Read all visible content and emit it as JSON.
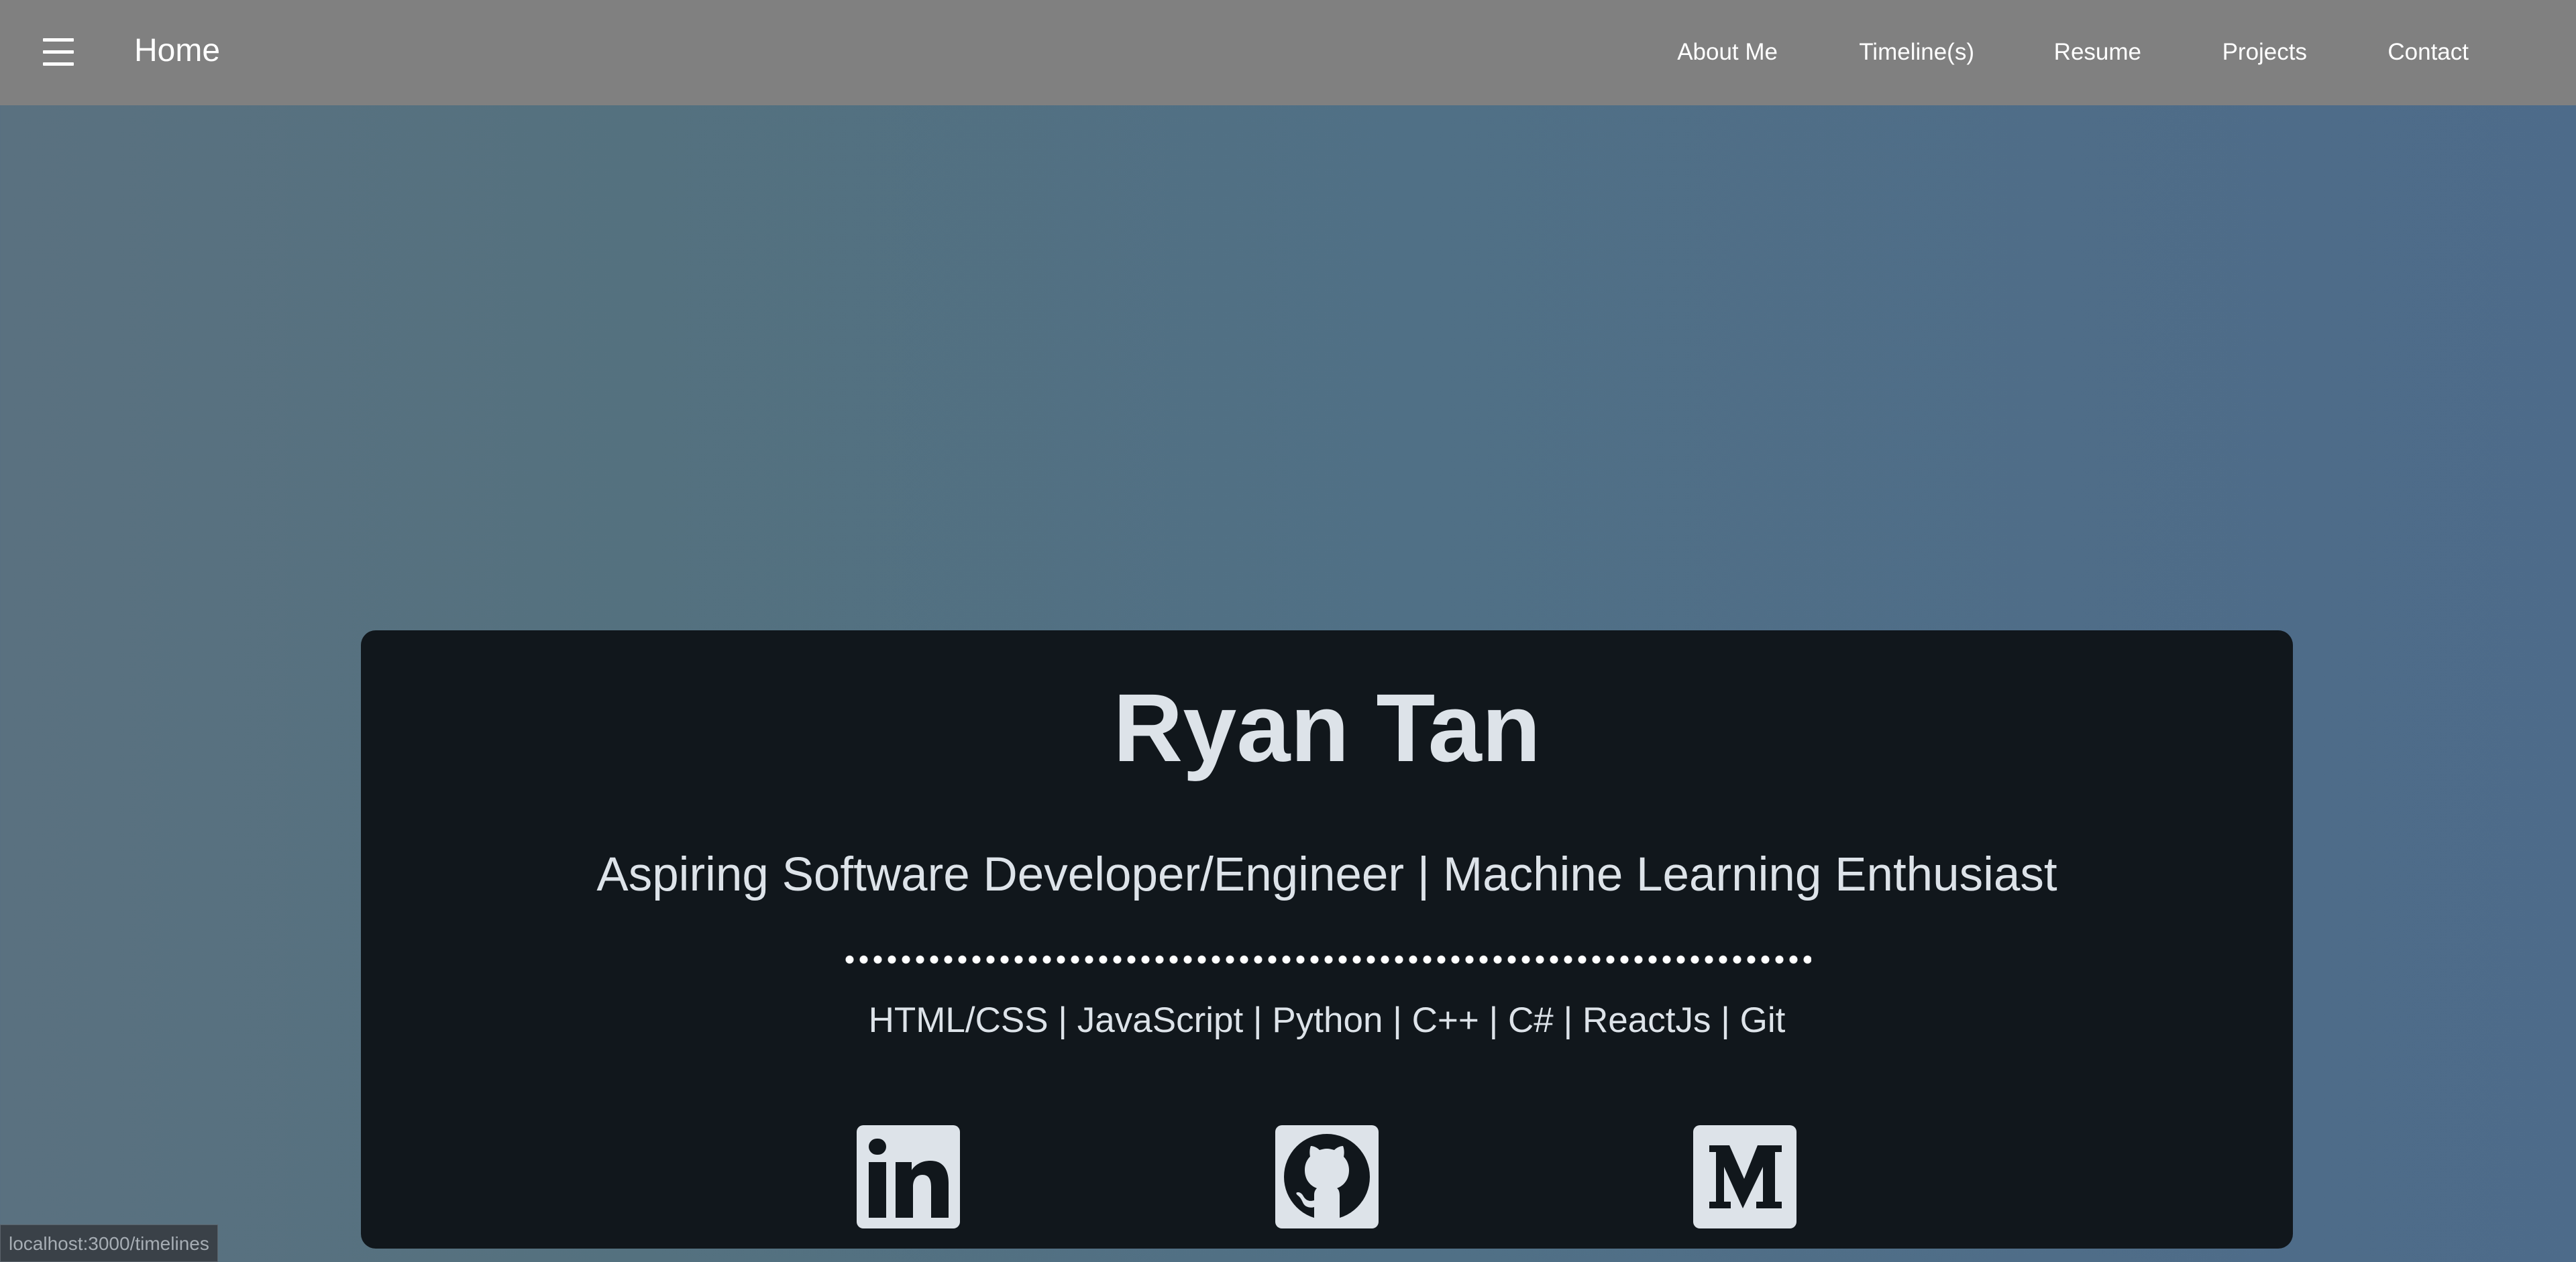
{
  "navbar": {
    "menu_icon": "hamburger-menu-icon",
    "home_label": "Home",
    "links": [
      "About Me",
      "Timeline(s)",
      "Resume",
      "Projects",
      "Contact"
    ]
  },
  "hero": {
    "name": "Ryan Tan",
    "subtitle": "Aspiring Software Developer/Engineer | Machine Learning Enthusiast",
    "skills": "HTML/CSS | JavaScript | Python | C++ | C# | ReactJs | Git",
    "social_icons": [
      "linkedin-icon",
      "github-icon",
      "medium-icon"
    ]
  },
  "status_bar": {
    "url": "localhost:3000/timelines"
  },
  "colors": {
    "navbar": "#808080",
    "card": "#11171c",
    "text": "#dde3e9",
    "background_left": "#5a7180",
    "background_right": "#4d6b8a"
  }
}
